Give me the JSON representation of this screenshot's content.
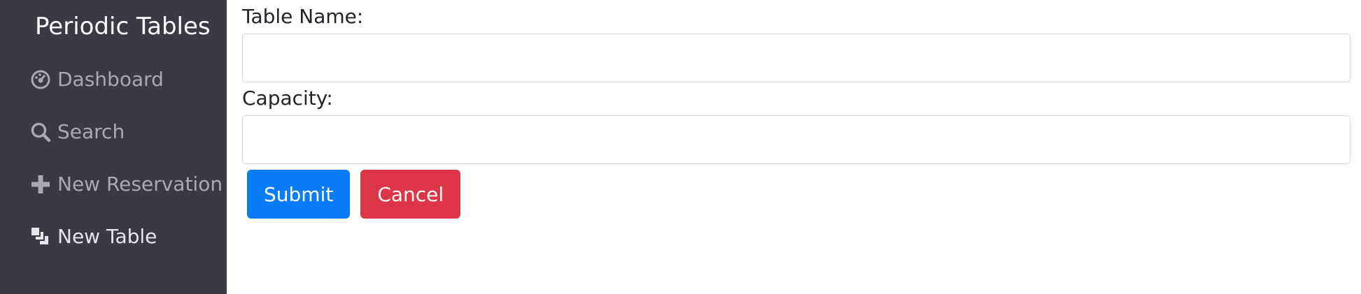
{
  "sidebar": {
    "brand": "Periodic Tables",
    "items": [
      {
        "label": "Dashboard",
        "icon": "dashboard-icon"
      },
      {
        "label": "Search",
        "icon": "search-icon"
      },
      {
        "label": "New Reservation",
        "icon": "plus-icon"
      },
      {
        "label": "New Table",
        "icon": "layers-icon"
      }
    ]
  },
  "form": {
    "table_name_label": "Table Name:",
    "table_name_value": "",
    "capacity_label": "Capacity:",
    "capacity_value": "",
    "submit_label": "Submit",
    "cancel_label": "Cancel"
  },
  "colors": {
    "sidebar_bg": "#3a3a44",
    "primary": "#0a7cf7",
    "danger": "#dc3545"
  }
}
